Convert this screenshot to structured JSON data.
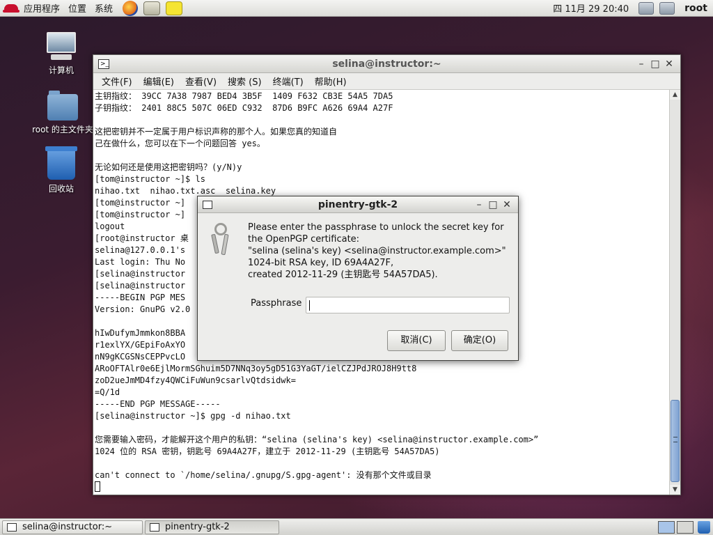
{
  "top_panel": {
    "menus": [
      "应用程序",
      "位置",
      "系统"
    ],
    "launchers": [
      "firefox-icon",
      "mail-icon",
      "notes-icon"
    ],
    "clock": "四 11月 29 20:40",
    "user": "root"
  },
  "desktop_icons": [
    {
      "label": "计算机",
      "icon": "computer-icon"
    },
    {
      "label": "root 的主文件夹",
      "icon": "home-folder-icon"
    },
    {
      "label": "回收站",
      "icon": "trash-icon"
    }
  ],
  "terminal": {
    "title": "selina@instructor:~",
    "menu": [
      "文件(F)",
      "编辑(E)",
      "查看(V)",
      "搜索 (S)",
      "终端(T)",
      "帮助(H)"
    ],
    "lines": [
      "主钥指纹： 39CC 7A38 7987 BED4 3B5F  1409 F632 CB3E 54A5 7DA5",
      "子钥指纹： 2401 88C5 507C 06ED C932  87D6 B9FC A626 69A4 A27F",
      "",
      "这把密钥并不一定属于用户标识声称的那个人。如果您真的知道自",
      "己在做什么，您可以在下一个问题回答 yes。",
      "",
      "无论如何还是使用这把密钥吗？(y/N)y",
      "[tom@instructor ~]$ ls",
      "nihao.txt  nihao.txt.asc  selina.key",
      "[tom@instructor ~]",
      "[tom@instructor ~]",
      "logout",
      "[root@instructor 桌",
      "selina@127.0.0.1's",
      "Last login: Thu No",
      "[selina@instructor",
      "[selina@instructor",
      "-----BEGIN PGP MES",
      "Version: GnuPG v2.0",
      "",
      "hIwDufymJmmkon8BBA",
      "r1exlYX/GEpiFoAxYO",
      "nN9gKCGSNsCEPPvcLO",
      "ARoOFTAlr0e6EjlMormSGhuim5D7NNq3oy5gD51G3YaGT/ielCZJPdJROJ8H9tt8",
      "zoD2ueJmMD4fzy4QWCiFuWun9csarlvQtdsidwk=",
      "=Q/1d",
      "-----END PGP MESSAGE-----",
      "[selina@instructor ~]$ gpg -d nihao.txt",
      "",
      "您需要输入密码，才能解开这个用户的私钥：“selina (selina's key) <selina@instructor.example.com>”",
      "1024 位的 RSA 密钥，钥匙号 69A4A27F，建立于 2012-11-29 (主钥匙号 54A57DA5)",
      "",
      "can't connect to `/home/selina/.gnupg/S.gpg-agent': 没有那个文件或目录",
      ""
    ]
  },
  "pinentry": {
    "title": "pinentry-gtk-2",
    "description": [
      "Please enter the passphrase to unlock the secret key for",
      "the OpenPGP certificate:",
      "\"selina (selina's key) <selina@instructor.example.com>\"",
      "1024-bit RSA key, ID 69A4A27F,",
      "created 2012-11-29 (主钥匙号 54A57DA5)."
    ],
    "passphrase_label": "Passphrase",
    "passphrase_value": "",
    "cancel_label": "取消(C)",
    "ok_label": "确定(O)"
  },
  "taskbar": {
    "tasks": [
      {
        "label": "selina@instructor:~",
        "icon": "terminal-icon"
      },
      {
        "label": "pinentry-gtk-2",
        "icon": "window-icon"
      }
    ]
  }
}
